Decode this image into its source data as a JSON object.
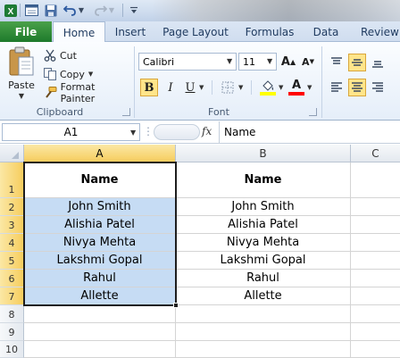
{
  "ribbon": {
    "tabs": [
      "File",
      "Home",
      "Insert",
      "Page Layout",
      "Formulas",
      "Data",
      "Review"
    ],
    "clipboard": {
      "paste": "Paste",
      "cut": "Cut",
      "copy": "Copy",
      "format_painter": "Format Painter",
      "group_label": "Clipboard"
    },
    "font": {
      "name": "Calibri",
      "size": "11",
      "group_label": "Font",
      "fill_color": "#ffff00",
      "font_color": "#ff0000"
    }
  },
  "formula_bar": {
    "name_box": "A1",
    "fx": "fx",
    "content": "Name"
  },
  "grid": {
    "columns": [
      "A",
      "B",
      "C"
    ],
    "rows": [
      "1",
      "2",
      "3",
      "4",
      "5",
      "6",
      "7",
      "8",
      "9",
      "10"
    ],
    "col_a": [
      "Name",
      "John Smith",
      "Alishia Patel",
      "Nivya Mehta",
      "Lakshmi Gopal",
      "Rahul",
      "Allette"
    ],
    "col_b": [
      "Name",
      "John Smith",
      "Alishia Patel",
      "Nivya Mehta",
      "Lakshmi Gopal",
      "Rahul",
      "Allette"
    ]
  },
  "colors": {
    "file_tab": "#2a8a38",
    "selection": "#c6dcf4",
    "header_highlight": "#f6cd5e"
  }
}
